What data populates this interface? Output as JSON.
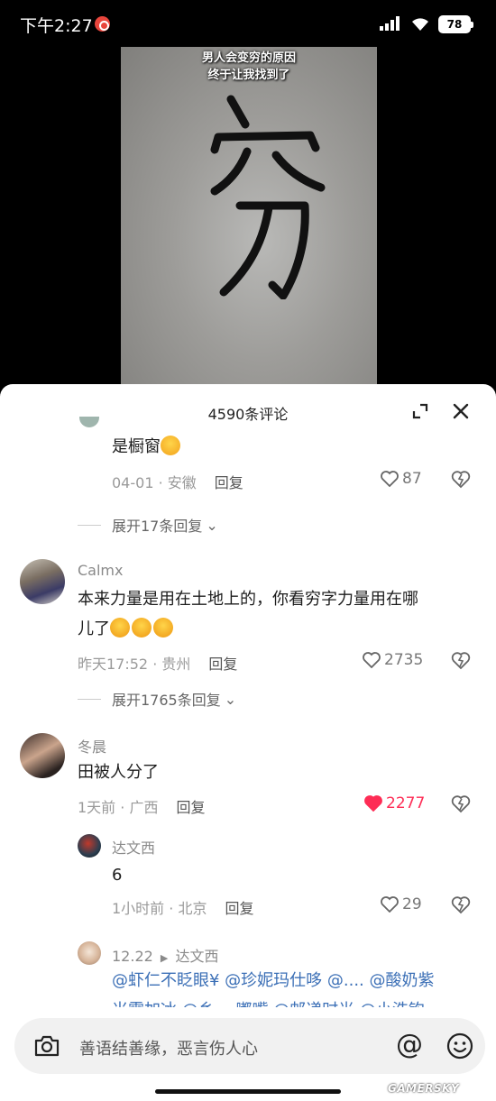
{
  "status_bar": {
    "time": "下午2:27",
    "battery": "78"
  },
  "video": {
    "caption_line1": "男人会变穷的原因",
    "caption_line2": "终于让我找到了"
  },
  "sheet": {
    "title": "4590条评论"
  },
  "comments": [
    {
      "text": "是橱窗",
      "date": "04-01",
      "location": "安徽",
      "reply_label": "回复",
      "likes": "87",
      "liked": false
    },
    {
      "expand_label": "展开17条回复"
    },
    {
      "username": "Calmx",
      "text_line1": "本来力量是用在土地上的，你看穷字力量用在哪",
      "text_line2": "儿了",
      "date": "昨天17:52",
      "location": "贵州",
      "reply_label": "回复",
      "likes": "2735",
      "liked": false,
      "expand_label": "展开1765条回复"
    },
    {
      "username": "冬晨",
      "text": "田被人分了",
      "date": "1天前",
      "location": "广西",
      "reply_label": "回复",
      "likes": "2277",
      "liked": true
    },
    {
      "username": "达文西",
      "text": "6",
      "date": "1小时前",
      "location": "北京",
      "reply_label": "回复",
      "likes": "29",
      "liked": false
    },
    {
      "username": "12.22",
      "reply_to": "达文西",
      "text_line1": "@虾仁不眨眼¥ @珍妮玛仕哆 @.... @酸奶紫",
      "text_line2": "米露加冰 @乡… 嘟嘴 @邮递时光 @小浩钩"
    }
  ],
  "input": {
    "placeholder": "善语结善缘，恶言伤人心",
    "at_symbol": "@"
  },
  "watermark": "GAMERSKY",
  "colors": {
    "like_active": "#fe2c55",
    "mention": "#3b6fb6"
  },
  "icons": [
    "camera-icon",
    "at-icon",
    "smile-icon",
    "heart-icon",
    "dislike-icon",
    "expand-icon",
    "close-icon"
  ]
}
